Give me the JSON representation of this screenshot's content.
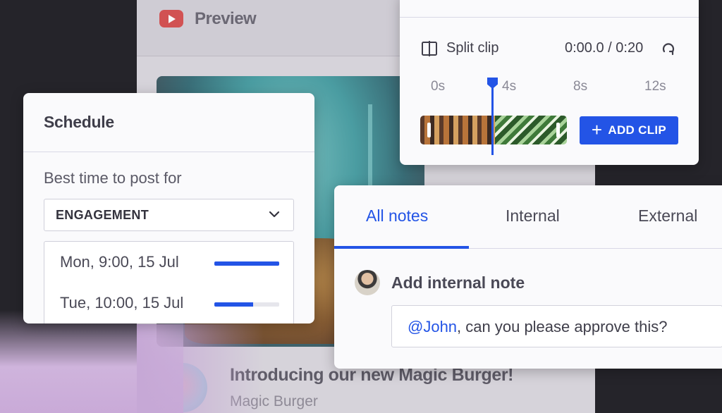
{
  "preview": {
    "title": "Preview",
    "post_title": "Introducing our new Magic Burger!",
    "post_author": "Magic Burger"
  },
  "schedule": {
    "title": "Schedule",
    "best_time_label": "Best time to post for",
    "metric_selected": "ENGAGEMENT",
    "times": [
      {
        "label": "Mon, 9:00, 15 Jul",
        "score": 1.0
      },
      {
        "label": "Tue, 10:00, 15 Jul",
        "score": 0.6
      }
    ]
  },
  "clip_editor": {
    "split_label": "Split clip",
    "timecode": "0:00.0 / 0:20",
    "ticks": [
      "0s",
      "4s",
      "8s",
      "12s"
    ],
    "add_clip_label": "ADD CLIP"
  },
  "notes": {
    "tabs": [
      "All notes",
      "Internal",
      "External"
    ],
    "active_tab": "All notes",
    "heading": "Add internal note",
    "input_mention": "@John",
    "input_text": ", can you please approve this?"
  },
  "colors": {
    "accent": "#2354e6",
    "background": "#25242a"
  }
}
